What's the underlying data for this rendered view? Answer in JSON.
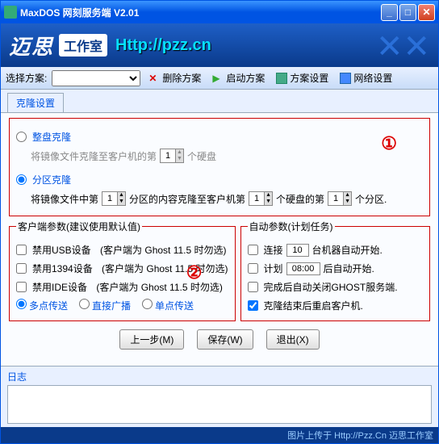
{
  "window": {
    "title": "MaxDOS 网刻服务端 V2.01"
  },
  "banner": {
    "logo": "迈思",
    "studio": "工作室",
    "url": "Http://pzz.cn"
  },
  "toolbar": {
    "scheme_label": "选择方案:",
    "delete": "删除方案",
    "start": "启动方案",
    "settings": "方案设置",
    "network": "网络设置"
  },
  "tabs": {
    "clone": "克隆设置"
  },
  "clone": {
    "full_radio": "整盘克隆",
    "full_text_pre": "将镜像文件克隆至客户机的第",
    "full_text_post": "个硬盘",
    "full_val": "1",
    "part_radio": "分区克隆",
    "part_t1": "将镜像文件中第",
    "part_v1": "1",
    "part_t2": "分区的内容克隆至客户机第",
    "part_v2": "1",
    "part_t3": "个硬盘的第",
    "part_v3": "1",
    "part_t4": "个分区.",
    "mark1": "①",
    "mark2": "②"
  },
  "client": {
    "legend": "客户端参数(建议使用默认值)",
    "usb": "禁用USB设备",
    "usb_note": "(客户端为 Ghost 11.5 时勿选)",
    "i1394": "禁用1394设备",
    "i1394_note": "(客户端为 Ghost 11.5 时勿选)",
    "ide": "禁用IDE设备",
    "ide_note": "(客户端为 Ghost 11.5 时勿选)",
    "r1": "多点传送",
    "r2": "直接广播",
    "r3": "单点传送"
  },
  "auto": {
    "legend": "自动参数(计划任务)",
    "conn": "连接",
    "conn_val": "10",
    "conn_post": "台机器自动开始.",
    "plan": "计划",
    "plan_val": "08:00",
    "plan_post": "后自动开始.",
    "close_ghost": "完成后自动关闭GHOST服务端.",
    "reboot": "克隆结束后重启客户机."
  },
  "buttons": {
    "prev": "上一步(M)",
    "save": "保存(W)",
    "exit": "退出(X)"
  },
  "log": {
    "label": "日志"
  },
  "footer": {
    "text": "图片上传于 Http://Pzz.Cn 迈思工作室"
  }
}
